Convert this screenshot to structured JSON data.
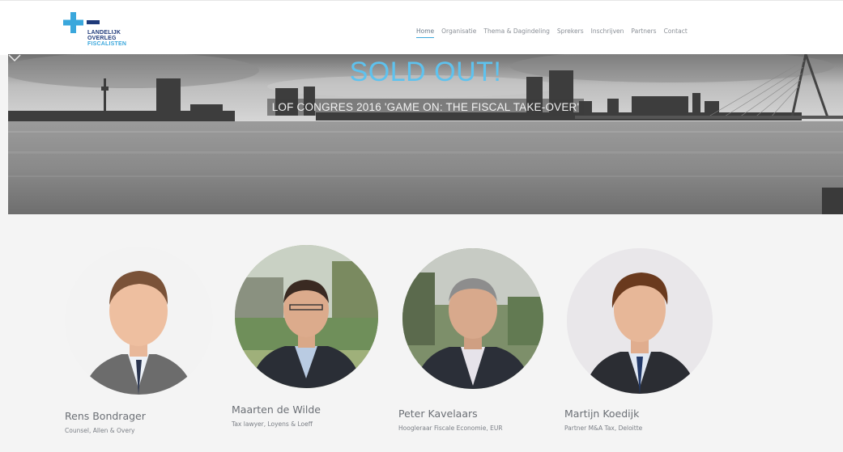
{
  "logo": {
    "lines": [
      "LANDELIJK",
      "OVERLEG",
      "FISCALISTEN"
    ],
    "colors": {
      "plus": "#3aa7dc",
      "minus": "#1f3a7a",
      "text_dark": "#1f3a7a",
      "text_light": "#3aa7dc"
    }
  },
  "nav": {
    "items": [
      "Home",
      "Organisatie",
      "Thema & Dagindeling",
      "Sprekers",
      "Inschrijven",
      "Partners",
      "Contact"
    ],
    "active_index": 0,
    "accent": "#3aa7dc"
  },
  "hero": {
    "headline": "SOLD OUT!",
    "subtitle": "LOF CONGRES 2016 'GAME ON: THE FISCAL TAKE-OVER'",
    "scroll_icon": "chevron-down-icon"
  },
  "speakers": [
    {
      "name": "Rens Bondrager",
      "role": "Counsel, Allen & Overy"
    },
    {
      "name": "Maarten de Wilde",
      "role": "Tax lawyer, Loyens & Loeff"
    },
    {
      "name": "Peter Kavelaars",
      "role": "Hoogleraar Fiscale Economie, EUR"
    },
    {
      "name": "Martijn Koedijk",
      "role": "Partner M&A Tax, Deloitte"
    }
  ]
}
